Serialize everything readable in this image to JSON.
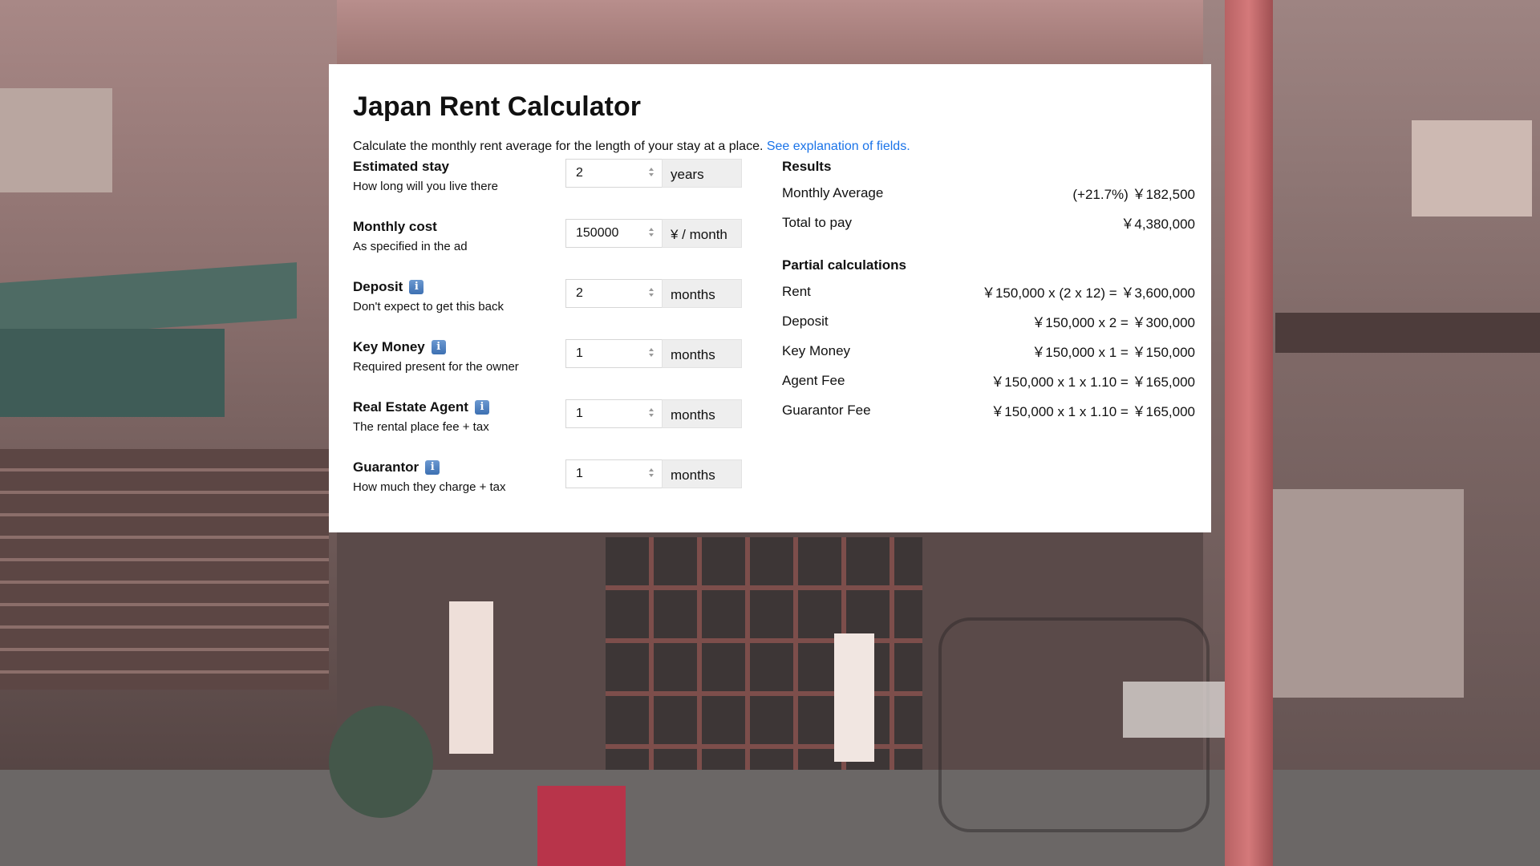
{
  "app": {
    "title": "Japan Rent Calculator",
    "intro_text": "Calculate the monthly rent average for the length of your stay at a place.",
    "intro_link": "See explanation of fields."
  },
  "fields": [
    {
      "label": "Estimated stay",
      "help": "How long will you live there",
      "value": "2",
      "unit": "years",
      "has_info_icon": false
    },
    {
      "label": "Monthly cost",
      "help": "As specified in the ad",
      "value": "150000",
      "unit": "¥ / month",
      "has_info_icon": false
    },
    {
      "label": "Deposit",
      "help": "Don't expect to get this back",
      "value": "2",
      "unit": "months",
      "has_info_icon": true
    },
    {
      "label": "Key Money",
      "help": "Required present for the owner",
      "value": "1",
      "unit": "months",
      "has_info_icon": true
    },
    {
      "label": "Real Estate Agent",
      "help": "The rental place fee + tax",
      "value": "1",
      "unit": "months",
      "has_info_icon": true
    },
    {
      "label": "Guarantor",
      "help": "How much they charge + tax",
      "value": "1",
      "unit": "months",
      "has_info_icon": true
    }
  ],
  "info_icon_glyph": "i",
  "results": {
    "title": "Results",
    "rows": [
      {
        "label": "Monthly Average",
        "value": "(+21.7%) ￥182,500"
      },
      {
        "label": "Total to pay",
        "value": "￥4,380,000"
      }
    ]
  },
  "partial": {
    "title": "Partial calculations",
    "rows": [
      {
        "label": "Rent",
        "value": "￥150,000 x (2 x 12) = ￥3,600,000"
      },
      {
        "label": "Deposit",
        "value": "￥150,000 x 2 = ￥300,000"
      },
      {
        "label": "Key Money",
        "value": "￥150,000 x 1 = ￥150,000"
      },
      {
        "label": "Agent Fee",
        "value": "￥150,000 x 1 x 1.10 = ￥165,000"
      },
      {
        "label": "Guarantor Fee",
        "value": "￥150,000 x 1 x 1.10 = ￥165,000"
      }
    ]
  },
  "colors": {
    "link": "#1a73e8",
    "info_icon": "#3d70b2",
    "unit_bg": "#eeeeee"
  }
}
